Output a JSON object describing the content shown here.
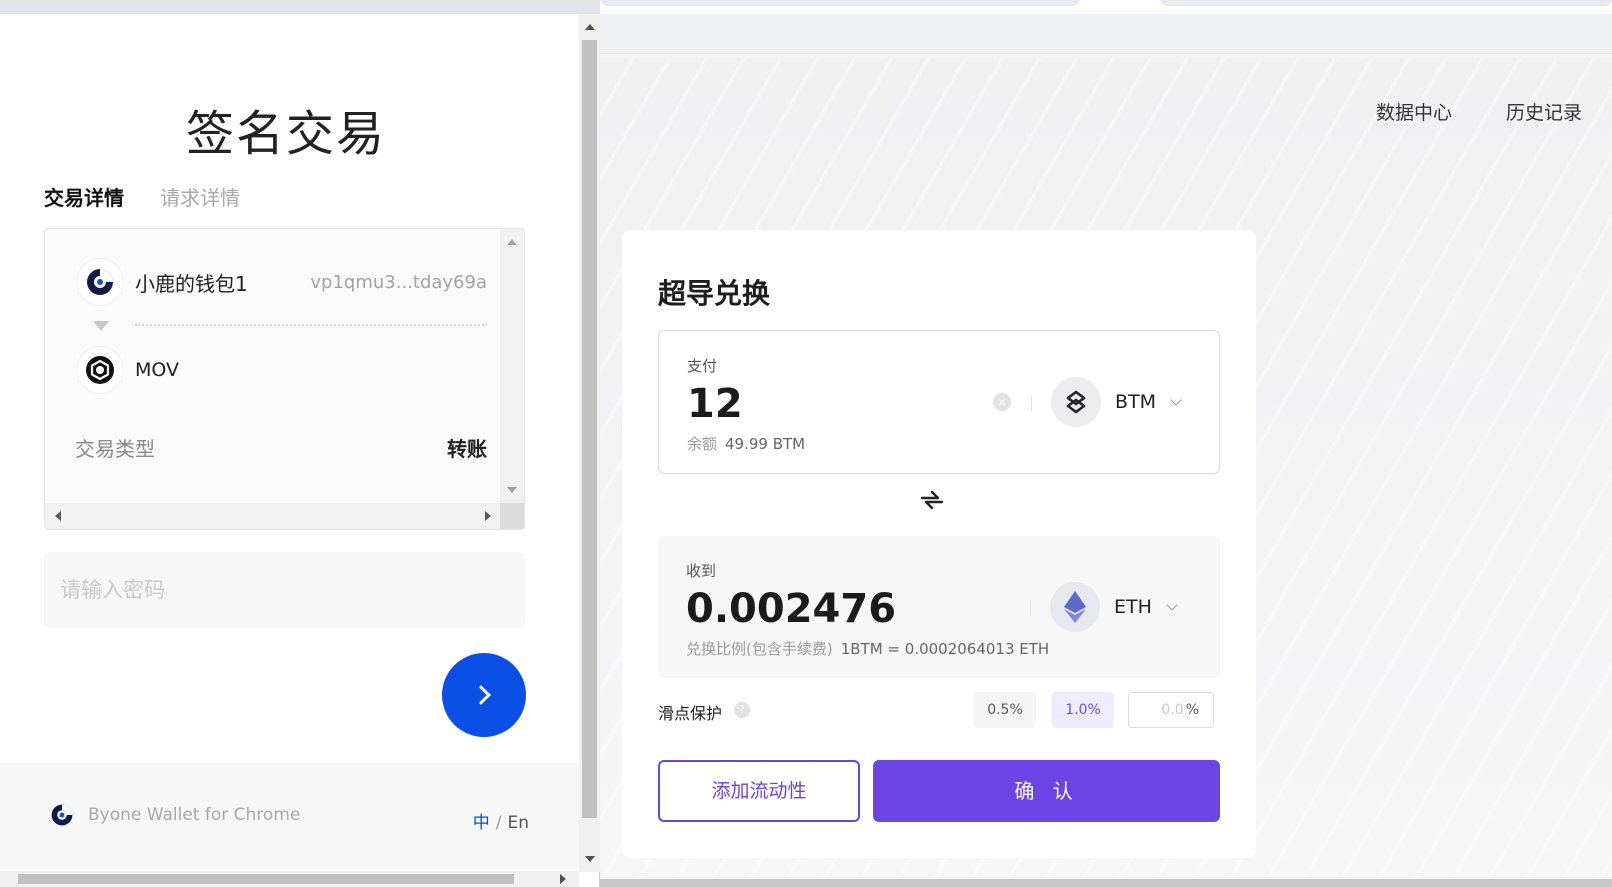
{
  "popup": {
    "title": "签名交易",
    "tabs": [
      "交易详情",
      "请求详情"
    ],
    "wallet_name": "小鹿的钱包1",
    "wallet_address": "vp1qmu3...tday69a",
    "asset": "MOV",
    "tx_type_label": "交易类型",
    "tx_type_value": "转账",
    "password_placeholder": "请输入密码",
    "footer_text": "Byone Wallet for Chrome",
    "lang_zh": "中",
    "lang_sep": "/",
    "lang_en": "En",
    "brand_color": "#0a4fe6"
  },
  "page": {
    "nav": [
      "数据中心",
      "历史记录"
    ],
    "swap": {
      "title": "超导兑换",
      "pay_label": "支付",
      "pay_amount": "12",
      "balance_label": "余额",
      "balance_value": "49.99 BTM",
      "pay_token": "BTM",
      "receive_label": "收到",
      "receive_amount": "0.002476",
      "rate_label": "兑换比例(包含手续费)",
      "rate_value": "1BTM = 0.0002064013 ETH",
      "receive_token": "ETH",
      "slippage_label": "滑点保护",
      "slippage_options": [
        "0.5%",
        "1.0%"
      ],
      "slippage_custom_placeholder": "0.0",
      "slippage_custom_unit": "%",
      "add_liquidity_label": "添加流动性",
      "confirm_label": "确 认",
      "accent_color": "#6b44e6"
    }
  }
}
